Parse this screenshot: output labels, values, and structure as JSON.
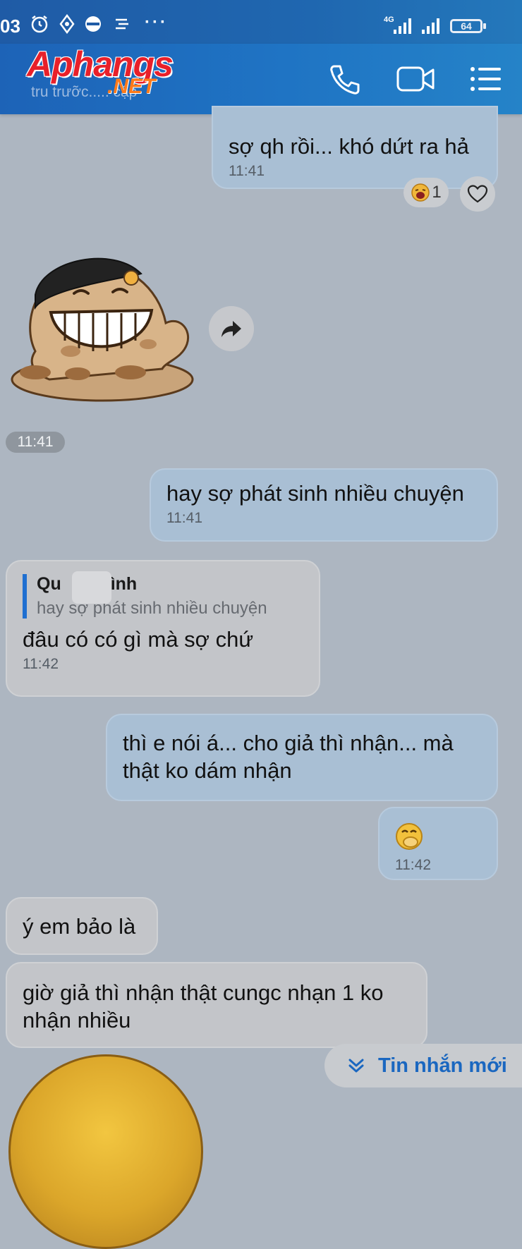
{
  "status_bar": {
    "time": "03",
    "network_type": "4G",
    "battery": "64"
  },
  "header": {
    "watermark_main": "Aphangs",
    "watermark_suffix": ".NET",
    "subtitle": "tru trưỡc..... cập"
  },
  "messages": [
    {
      "dir": "out",
      "text": "sợ qh rồi... khó dứt ra hả",
      "time": "11:41",
      "reaction_count": "1"
    },
    {
      "dir": "in",
      "type": "sticker",
      "time": "11:41"
    },
    {
      "dir": "out",
      "text": "hay sợ phát sinh nhiều chuyện",
      "time": "11:41"
    },
    {
      "dir": "in",
      "quote_name_left": "Qu",
      "quote_name_right": "ình",
      "quote_text": "hay sợ phát sinh nhiều chuyện",
      "text": "đâu có có gì mà sợ chứ",
      "time": "11:42"
    },
    {
      "dir": "out",
      "text": "thì e nói á... cho giả thì nhận... mà thật ko dám nhận"
    },
    {
      "dir": "out",
      "type": "emoji",
      "emoji": "🤭",
      "time": "11:42"
    },
    {
      "dir": "in",
      "text": "ý em bảo là"
    },
    {
      "dir": "in",
      "text": "giờ giả thì nhận thật cungc nhạn 1 ko nhận nhiều"
    }
  ],
  "new_messages_button": {
    "label": "Tin nhắn mới"
  }
}
